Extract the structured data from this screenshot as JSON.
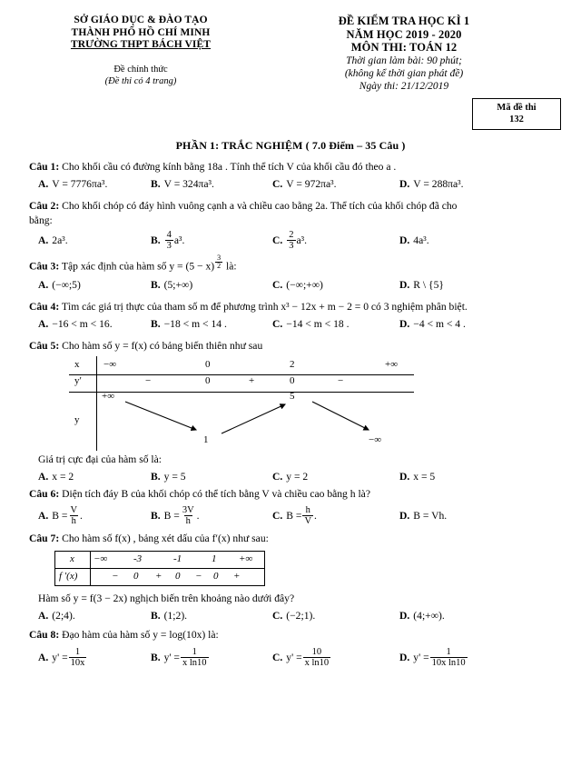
{
  "header": {
    "left": {
      "line1": "SỞ GIÁO DỤC & ĐÀO TẠO",
      "line2": "THÀNH PHỐ HỒ CHÍ MINH",
      "line3": "TRƯỜNG THPT BÁCH  VIỆT",
      "official": "Đề chính thức",
      "pages": "(Đề thi có 4 trang)"
    },
    "right": {
      "title1": "ĐỀ KIỂM TRA HỌC KÌ 1",
      "title2": "NĂM HỌC 2019 - 2020",
      "title3": "MÔN THI: TOÁN 12",
      "info1": "Thời gian làm bài: 90 phút;",
      "info2": "(không kể thời gian phát đề)",
      "info3": "Ngày thi: 21/12/2019"
    },
    "code_box": {
      "label": "Mã đề thi",
      "value": "132"
    }
  },
  "section_title": "PHẦN 1: TRẮC NGHIỆM ( 7.0 Điểm – 35 Câu )",
  "questions": [
    {
      "label": "Câu 1:",
      "stem": "Cho khối cầu có đường kính bằng 18a . Tính thể tích V  của khối cầu đó theo a .",
      "options": [
        {
          "letter": "A.",
          "text": "V = 7776πa³."
        },
        {
          "letter": "B.",
          "text": "V = 324πa³."
        },
        {
          "letter": "C.",
          "text": "V = 972πa³."
        },
        {
          "letter": "D.",
          "text": "V = 288πa³."
        }
      ]
    },
    {
      "label": "Câu 2:",
      "stem": "Cho khối chóp có đáy hình vuông cạnh a và chiều cao bằng 2a. Thể tích của khối chóp đã cho",
      "stem2": "bằng:",
      "options": [
        {
          "letter": "A.",
          "text": "2a³."
        },
        {
          "letter": "B.",
          "num": "4",
          "den": "3",
          "suffix": "a³."
        },
        {
          "letter": "C.",
          "num": "2",
          "den": "3",
          "suffix": "a³."
        },
        {
          "letter": "D.",
          "text": "4a³."
        }
      ]
    },
    {
      "label": "Câu 3:",
      "stem_pre": "Tập xác định của hàm số  y = (5 − x)",
      "exp_num": "3",
      "exp_den": "2",
      "stem_post": " là:",
      "options": [
        {
          "letter": "A.",
          "text": "(−∞;5)"
        },
        {
          "letter": "B.",
          "text": "(5;+∞)"
        },
        {
          "letter": "C.",
          "text": "(−∞;+∞)"
        },
        {
          "letter": "D.",
          "text": "R \\ {5}"
        }
      ]
    },
    {
      "label": "Câu 4:",
      "stem": "Tìm các giá trị thực của tham số m để phương trình x³ − 12x + m − 2 = 0  có 3 nghiệm phân biệt.",
      "options": [
        {
          "letter": "A.",
          "text": "−16 < m < 16."
        },
        {
          "letter": "B.",
          "text": "−18 < m < 14 ."
        },
        {
          "letter": "C.",
          "text": "−14 < m < 18 ."
        },
        {
          "letter": "D.",
          "text": "−4 < m < 4 ."
        }
      ]
    },
    {
      "label": "Câu 5:",
      "stem": "Cho hàm số  y = f(x) có bảng biến thiên như sau",
      "question_line": "Giá trị cực đại của hàm số là:",
      "options": [
        {
          "letter": "A.",
          "text": "x = 2"
        },
        {
          "letter": "B.",
          "text": "y = 5"
        },
        {
          "letter": "C.",
          "text": "y = 2"
        },
        {
          "letter": "D.",
          "text": "x = 5"
        }
      ]
    },
    {
      "label": "Câu 6:",
      "stem": "Diện tích đáy B  của khối chóp có thể tích bằng  V và chiều cao bằng h  là?",
      "options": [
        {
          "letter": "A.",
          "prefix": "B = ",
          "num": "V",
          "den": "h",
          "suffix": "."
        },
        {
          "letter": "B.",
          "prefix": "B = ",
          "num": "3V",
          "den": "h",
          "suffix": "."
        },
        {
          "letter": "C.",
          "prefix": "B = ",
          "num": "h",
          "den": "V",
          "suffix": "."
        },
        {
          "letter": "D.",
          "text": "B = Vh."
        }
      ]
    },
    {
      "label": "Câu 7:",
      "stem": "Cho hàm số f(x) , bảng xét dấu của f′(x) như sau:",
      "question_line": "Hàm số y = f(3 − 2x) nghịch biến trên khoảng nào dưới đây?",
      "options": [
        {
          "letter": "A.",
          "text": "(2;4)."
        },
        {
          "letter": "B.",
          "text": "(1;2)."
        },
        {
          "letter": "C.",
          "text": "(−2;1)."
        },
        {
          "letter": "D.",
          "text": "(4;+∞)."
        }
      ]
    },
    {
      "label": "Câu 8:",
      "stem": "Đạo hàm của hàm số  y = log(10x)  là:",
      "options": [
        {
          "letter": "A.",
          "prefix": "y' = ",
          "num": "1",
          "den": "10x"
        },
        {
          "letter": "B.",
          "prefix": "y' = ",
          "num": "1",
          "den": "x ln10"
        },
        {
          "letter": "C.",
          "prefix": "y' = ",
          "num": "10",
          "den": "x ln10"
        },
        {
          "letter": "D.",
          "prefix": "y' = ",
          "num": "1",
          "den": "10x ln10"
        }
      ]
    }
  ],
  "variation_table": {
    "row_labels": {
      "x": "x",
      "yprime": "y′",
      "y": "y"
    },
    "x_values": [
      "−∞",
      "0",
      "2",
      "+∞"
    ],
    "yprime_values": [
      "−",
      "0",
      "+",
      "0",
      "−"
    ],
    "y_values": [
      "+∞",
      "1",
      "5",
      "−∞"
    ]
  },
  "sign_table": {
    "row_labels": {
      "x": "x",
      "fprime": "f '(x)"
    },
    "x_values": [
      "−∞",
      "-3",
      "-1",
      "1",
      "+∞"
    ],
    "fprime_values": [
      "−",
      "0",
      "+",
      "0",
      "−",
      "0",
      "+"
    ]
  }
}
